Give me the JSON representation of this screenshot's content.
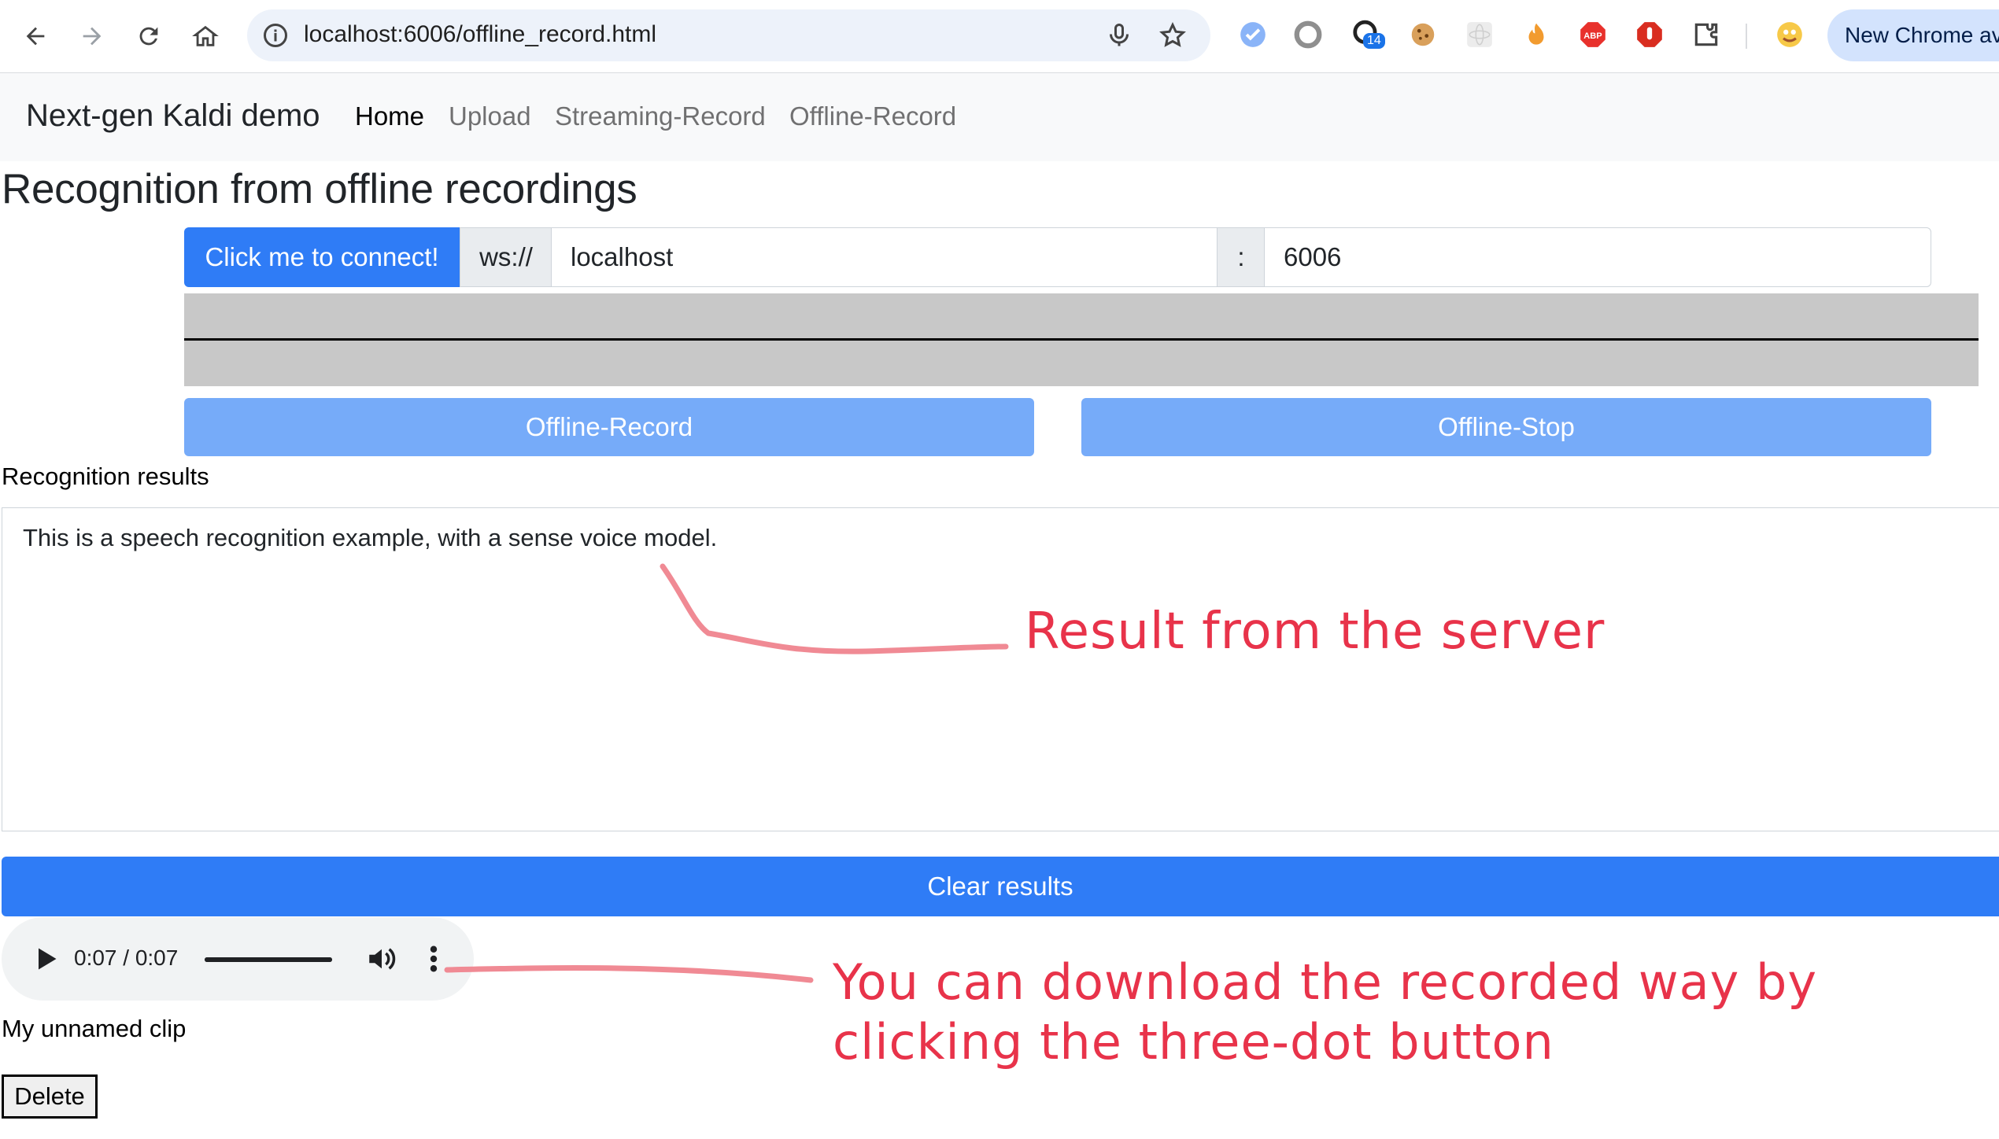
{
  "browser": {
    "url": "localhost:6006/offline_record.html",
    "new_chrome_label": "New Chrome ava",
    "extension_badge_count": "14",
    "abp_label": "ABP"
  },
  "navbar": {
    "brand": "Next-gen Kaldi demo",
    "links": [
      "Home",
      "Upload",
      "Streaming-Record",
      "Offline-Record"
    ],
    "active": "Home"
  },
  "page": {
    "title": "Recognition from offline recordings"
  },
  "connect": {
    "button_label": "Click me to connect!",
    "scheme": "ws://",
    "host": "localhost",
    "separator": ":",
    "port": "6006"
  },
  "controls": {
    "record_label": "Offline-Record",
    "stop_label": "Offline-Stop"
  },
  "results": {
    "label": "Recognition results",
    "text": "This is a speech recognition example, with a sense voice model.",
    "clear_label": "Clear results"
  },
  "audio": {
    "time": "0:07 / 0:07",
    "progress": 1.0
  },
  "clip": {
    "name": "My unnamed clip",
    "delete_label": "Delete"
  },
  "annotations": {
    "server_result": "Result from the server",
    "download_line1": "You can download the recorded way by",
    "download_line2": "clicking the three-dot button"
  },
  "colors": {
    "primary": "#2f7cf6",
    "primary_disabled": "#76abf9",
    "annotation": "#e8334a"
  }
}
